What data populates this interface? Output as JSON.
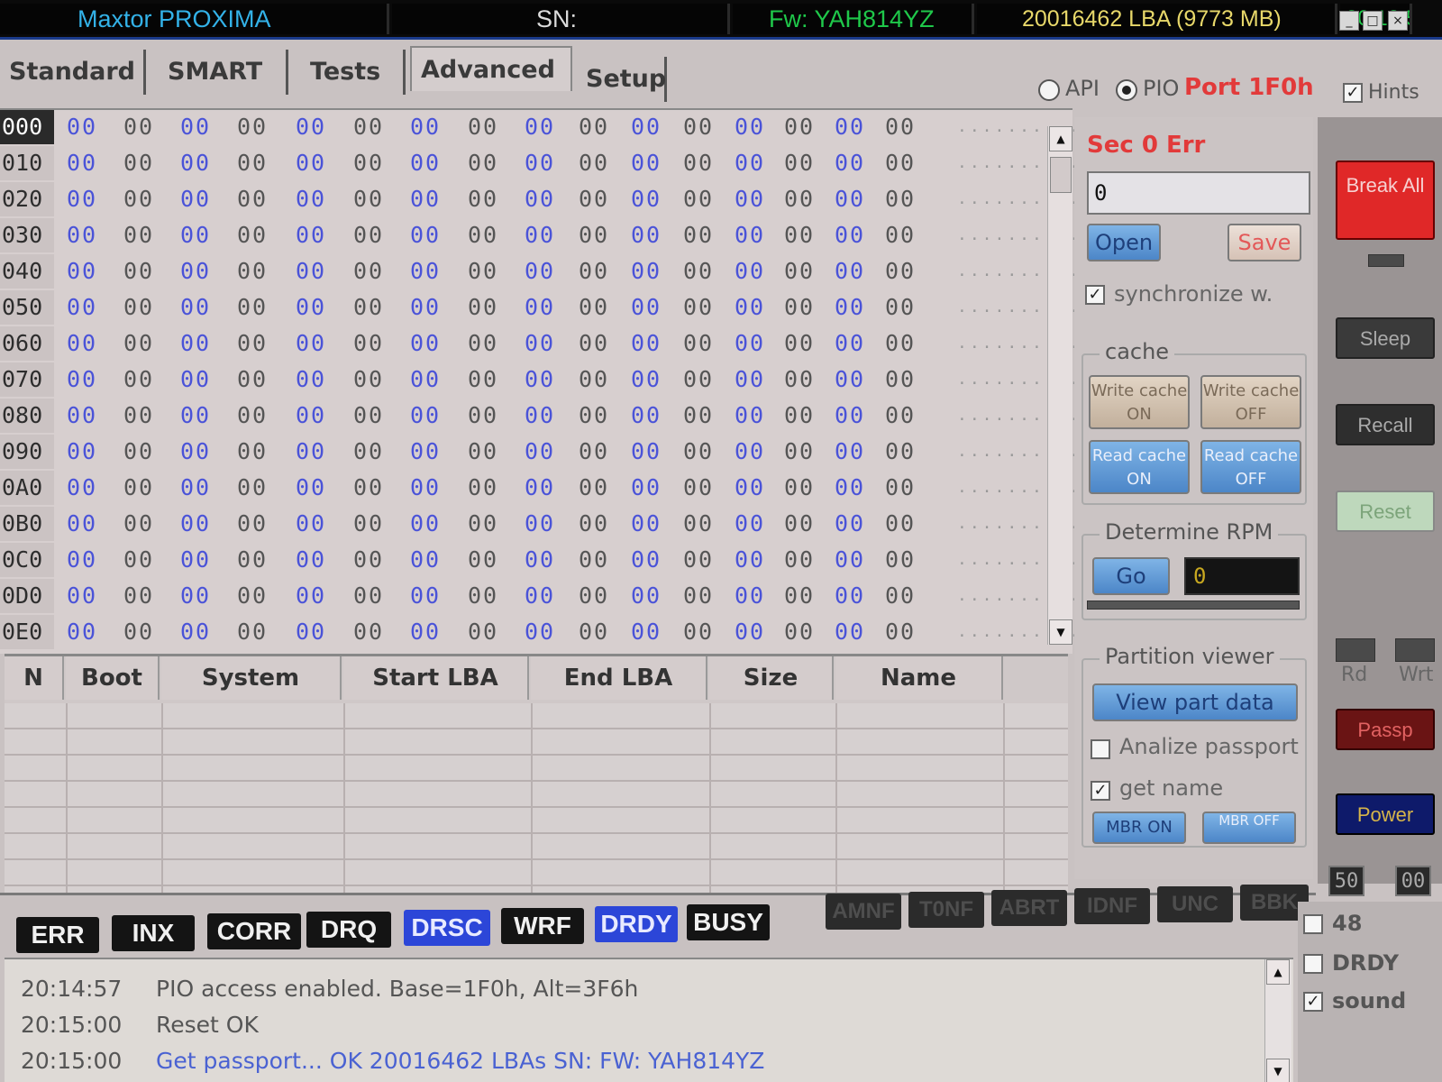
{
  "header": {
    "model": "Maxtor PROXIMA",
    "sn": "SN:",
    "fw": "Fw: YAH814YZ",
    "lba": "20016462 LBA (9773 MB)",
    "time": "20:18:54",
    "window_buttons": [
      "_",
      "□",
      "×"
    ]
  },
  "tabs": [
    "Standard",
    "SMART",
    "Tests",
    "Advanced",
    "Setup"
  ],
  "mode": {
    "api_label": "API",
    "pio_label": "PIO",
    "port_label": "Port 1F0h",
    "hints_label": "Hints"
  },
  "hex": {
    "offsets": [
      "000",
      "010",
      "020",
      "030",
      "040",
      "050",
      "060",
      "070",
      "080",
      "090",
      "0A0",
      "0B0",
      "0C0",
      "0D0",
      "0E0"
    ],
    "byte": "00",
    "ascii": "................"
  },
  "partition_table": {
    "columns": [
      "N",
      "Boot",
      "System",
      "Start LBA",
      "End LBA",
      "Size",
      "Name"
    ]
  },
  "control": {
    "sec_label": "Sec 0 Err",
    "sec_value": "0",
    "open": "Open",
    "save": "Save",
    "synchronize": "synchronize w.",
    "cache_title": "cache",
    "write_cache_on": "Write cache ON",
    "write_cache_off": "Write cache OFF",
    "read_cache_on": "Read cache ON",
    "read_cache_off": "Read cache OFF",
    "rpm_title": "Determine RPM",
    "go": "Go",
    "rpm_value": "0",
    "partition_title": "Partition viewer",
    "view_part_data": "View part data",
    "analize_passport": "Analize passport",
    "get_name": "get name",
    "mbr_on": "MBR ON",
    "mbr_off": "MBR OFF"
  },
  "strip": {
    "break_all": "Break All",
    "sleep": "Sleep",
    "recall": "Recall",
    "reset": "Reset",
    "rd": "Rd",
    "wrt": "Wrt",
    "passp": "Passp",
    "power": "Power",
    "box_50": "50",
    "box_00": "00"
  },
  "flags": {
    "active": [
      "ERR",
      "INX",
      "CORR",
      "DRQ",
      "DRSC",
      "WRF",
      "DRDY",
      "BUSY"
    ],
    "error": [
      "AMNF",
      "T0NF",
      "ABRT",
      "IDNF",
      "UNC",
      "BBK"
    ]
  },
  "log": [
    {
      "time": "20:14:57",
      "msg": "PIO access enabled. Base=1F0h, Alt=3F6h"
    },
    {
      "time": "20:15:00",
      "msg": "Reset OK"
    },
    {
      "time": "20:15:00",
      "msg": "Get passport... OK         20016462 LBAs  SN:     FW: YAH814YZ"
    }
  ],
  "bottom_options": {
    "opt48": "48",
    "drdy": "DRDY",
    "sound": "sound"
  },
  "colors": {
    "flag_blue": "#2c46d8",
    "sec_red": "#e23a3a",
    "break_red": "#e02828"
  }
}
